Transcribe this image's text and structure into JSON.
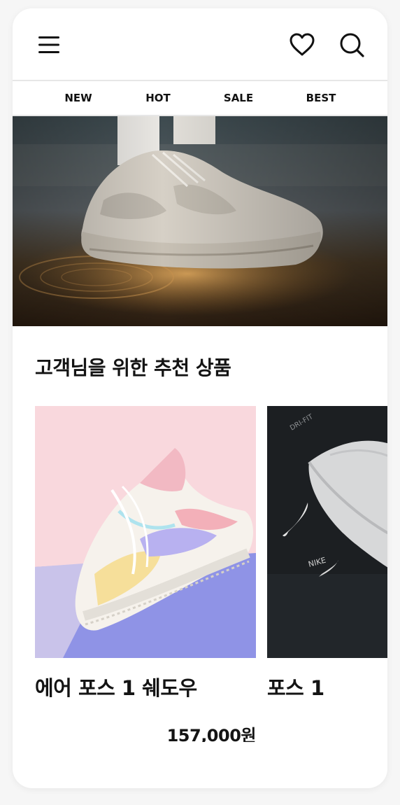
{
  "header": {
    "menu_icon": "hamburger-menu-icon",
    "wishlist_icon": "heart-icon",
    "search_icon": "search-icon"
  },
  "tabs": [
    {
      "label": "NEW"
    },
    {
      "label": "HOT"
    },
    {
      "label": "SALE"
    },
    {
      "label": "BEST"
    }
  ],
  "hero": {
    "image": "sneaker-banner-image"
  },
  "recommend": {
    "title": "고객님을 위한 추천 상품",
    "products": [
      {
        "name": "에어 포스 1 쉐도우",
        "price": "157,000원",
        "image": "pastel-sneaker-image"
      },
      {
        "name": "포스 1",
        "price": "",
        "image": "white-sneaker-dark-image"
      }
    ]
  },
  "colors": {
    "text": "#141414",
    "divider": "#e7e7e7",
    "background": "#f6f6f6",
    "card": "#ffffff"
  }
}
